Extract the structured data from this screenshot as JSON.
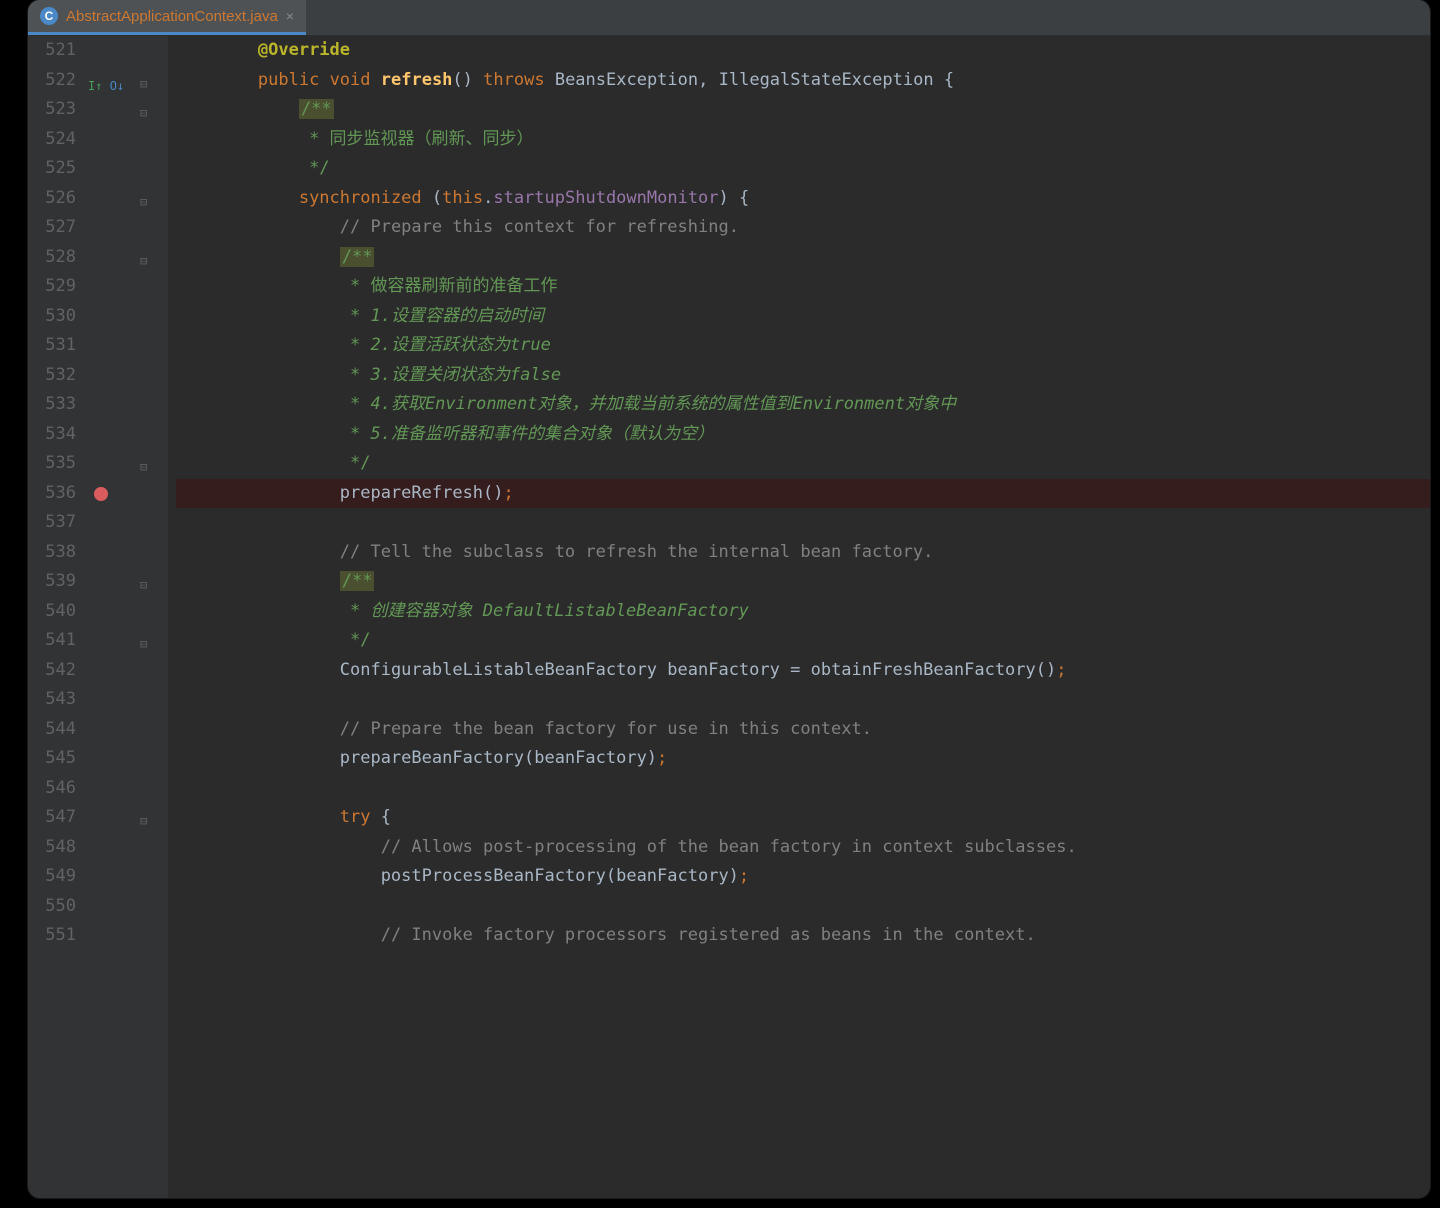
{
  "tab": {
    "filename": "AbstractApplicationContext.java"
  },
  "line_start": 521,
  "breakpoint_line": 536,
  "override_marker_line": 522,
  "fold_lines": [
    522,
    523,
    526,
    528,
    535,
    539,
    541,
    547
  ],
  "lines": {
    "521": {
      "tokens": [
        [
          "ann",
          "@Override"
        ]
      ],
      "indent": 2
    },
    "522": {
      "tokens": [
        [
          "kw",
          "public"
        ],
        [
          "",
          ""
        ],
        [
          "kw",
          "void"
        ],
        [
          "",
          ""
        ],
        [
          "mname",
          "refresh"
        ],
        [
          "punc",
          "()"
        ],
        [
          "",
          ""
        ],
        [
          "kw",
          "throws"
        ],
        [
          "",
          ""
        ],
        [
          "type",
          "BeansException"
        ],
        [
          "punc",
          ","
        ],
        [
          "",
          ""
        ],
        [
          "type",
          "IllegalStateException"
        ],
        [
          "",
          ""
        ],
        [
          "punc",
          "{"
        ]
      ],
      "indent": 2
    },
    "523": {
      "tokens": [
        [
          "docmark",
          "/**"
        ]
      ],
      "indent": 3
    },
    "524": {
      "tokens": [
        [
          "docblock",
          " * 同步监视器（刷新、同步）"
        ]
      ],
      "indent": 3
    },
    "525": {
      "tokens": [
        [
          "docblock",
          " */"
        ]
      ],
      "indent": 3
    },
    "526": {
      "tokens": [
        [
          "kw",
          "synchronized"
        ],
        [
          "",
          ""
        ],
        [
          "punc",
          "("
        ],
        [
          "kw",
          "this"
        ],
        [
          "punc",
          "."
        ],
        [
          "field",
          "startupShutdownMonitor"
        ],
        [
          "punc",
          ")"
        ],
        [
          "",
          ""
        ],
        [
          "punc",
          "{"
        ]
      ],
      "indent": 3
    },
    "527": {
      "tokens": [
        [
          "cmt",
          "// Prepare this context for refreshing."
        ]
      ],
      "indent": 4
    },
    "528": {
      "tokens": [
        [
          "docmark",
          "/**"
        ]
      ],
      "indent": 4
    },
    "529": {
      "tokens": [
        [
          "docblock",
          " * 做容器刷新前的准备工作"
        ]
      ],
      "indent": 4
    },
    "530": {
      "tokens": [
        [
          "doc",
          " * 1.设置容器的启动时间"
        ]
      ],
      "indent": 4
    },
    "531": {
      "tokens": [
        [
          "doc",
          " * 2.设置活跃状态为true"
        ]
      ],
      "indent": 4
    },
    "532": {
      "tokens": [
        [
          "doc",
          " * 3.设置关闭状态为false"
        ]
      ],
      "indent": 4
    },
    "533": {
      "tokens": [
        [
          "doc",
          " * 4.获取Environment对象，并加载当前系统的属性值到Environment对象中"
        ]
      ],
      "indent": 4
    },
    "534": {
      "tokens": [
        [
          "doc",
          " * 5.准备监听器和事件的集合对象（默认为空）"
        ]
      ],
      "indent": 4
    },
    "535": {
      "tokens": [
        [
          "docblock",
          " */"
        ]
      ],
      "indent": 4
    },
    "536": {
      "tokens": [
        [
          "",
          "prepareRefresh()"
        ],
        [
          "kw",
          ";"
        ]
      ],
      "indent": 4
    },
    "537": {
      "tokens": [],
      "indent": 0
    },
    "538": {
      "tokens": [
        [
          "cmt",
          "// Tell the subclass to refresh the internal bean factory."
        ]
      ],
      "indent": 4
    },
    "539": {
      "tokens": [
        [
          "docmark",
          "/**"
        ]
      ],
      "indent": 4
    },
    "540": {
      "tokens": [
        [
          "doc",
          " * 创建容器对象 DefaultListableBeanFactory"
        ]
      ],
      "indent": 4
    },
    "541": {
      "tokens": [
        [
          "docblock",
          " */"
        ]
      ],
      "indent": 4
    },
    "542": {
      "tokens": [
        [
          "type",
          "ConfigurableListableBeanFactory"
        ],
        [
          "",
          ""
        ],
        [
          "",
          "beanFactory"
        ],
        [
          "",
          ""
        ],
        [
          "punc",
          "="
        ],
        [
          "",
          ""
        ],
        [
          "",
          "obtainFreshBeanFactory()"
        ],
        [
          "kw",
          ";"
        ]
      ],
      "indent": 4
    },
    "543": {
      "tokens": [],
      "indent": 0
    },
    "544": {
      "tokens": [
        [
          "cmt",
          "// Prepare the bean factory for use in this context."
        ]
      ],
      "indent": 4
    },
    "545": {
      "tokens": [
        [
          "",
          "prepareBeanFactory(beanFactory)"
        ],
        [
          "kw",
          ";"
        ]
      ],
      "indent": 4
    },
    "546": {
      "tokens": [],
      "indent": 0
    },
    "547": {
      "tokens": [
        [
          "kw",
          "try"
        ],
        [
          "",
          ""
        ],
        [
          "punc",
          "{"
        ]
      ],
      "indent": 4
    },
    "548": {
      "tokens": [
        [
          "cmt",
          "// Allows post-processing of the bean factory in context subclasses."
        ]
      ],
      "indent": 5
    },
    "549": {
      "tokens": [
        [
          "",
          "postProcessBeanFactory(beanFactory)"
        ],
        [
          "kw",
          ";"
        ]
      ],
      "indent": 5
    },
    "550": {
      "tokens": [],
      "indent": 0
    },
    "551": {
      "tokens": [
        [
          "cmt",
          "// Invoke factory processors registered as beans in the context."
        ]
      ],
      "indent": 5
    }
  }
}
